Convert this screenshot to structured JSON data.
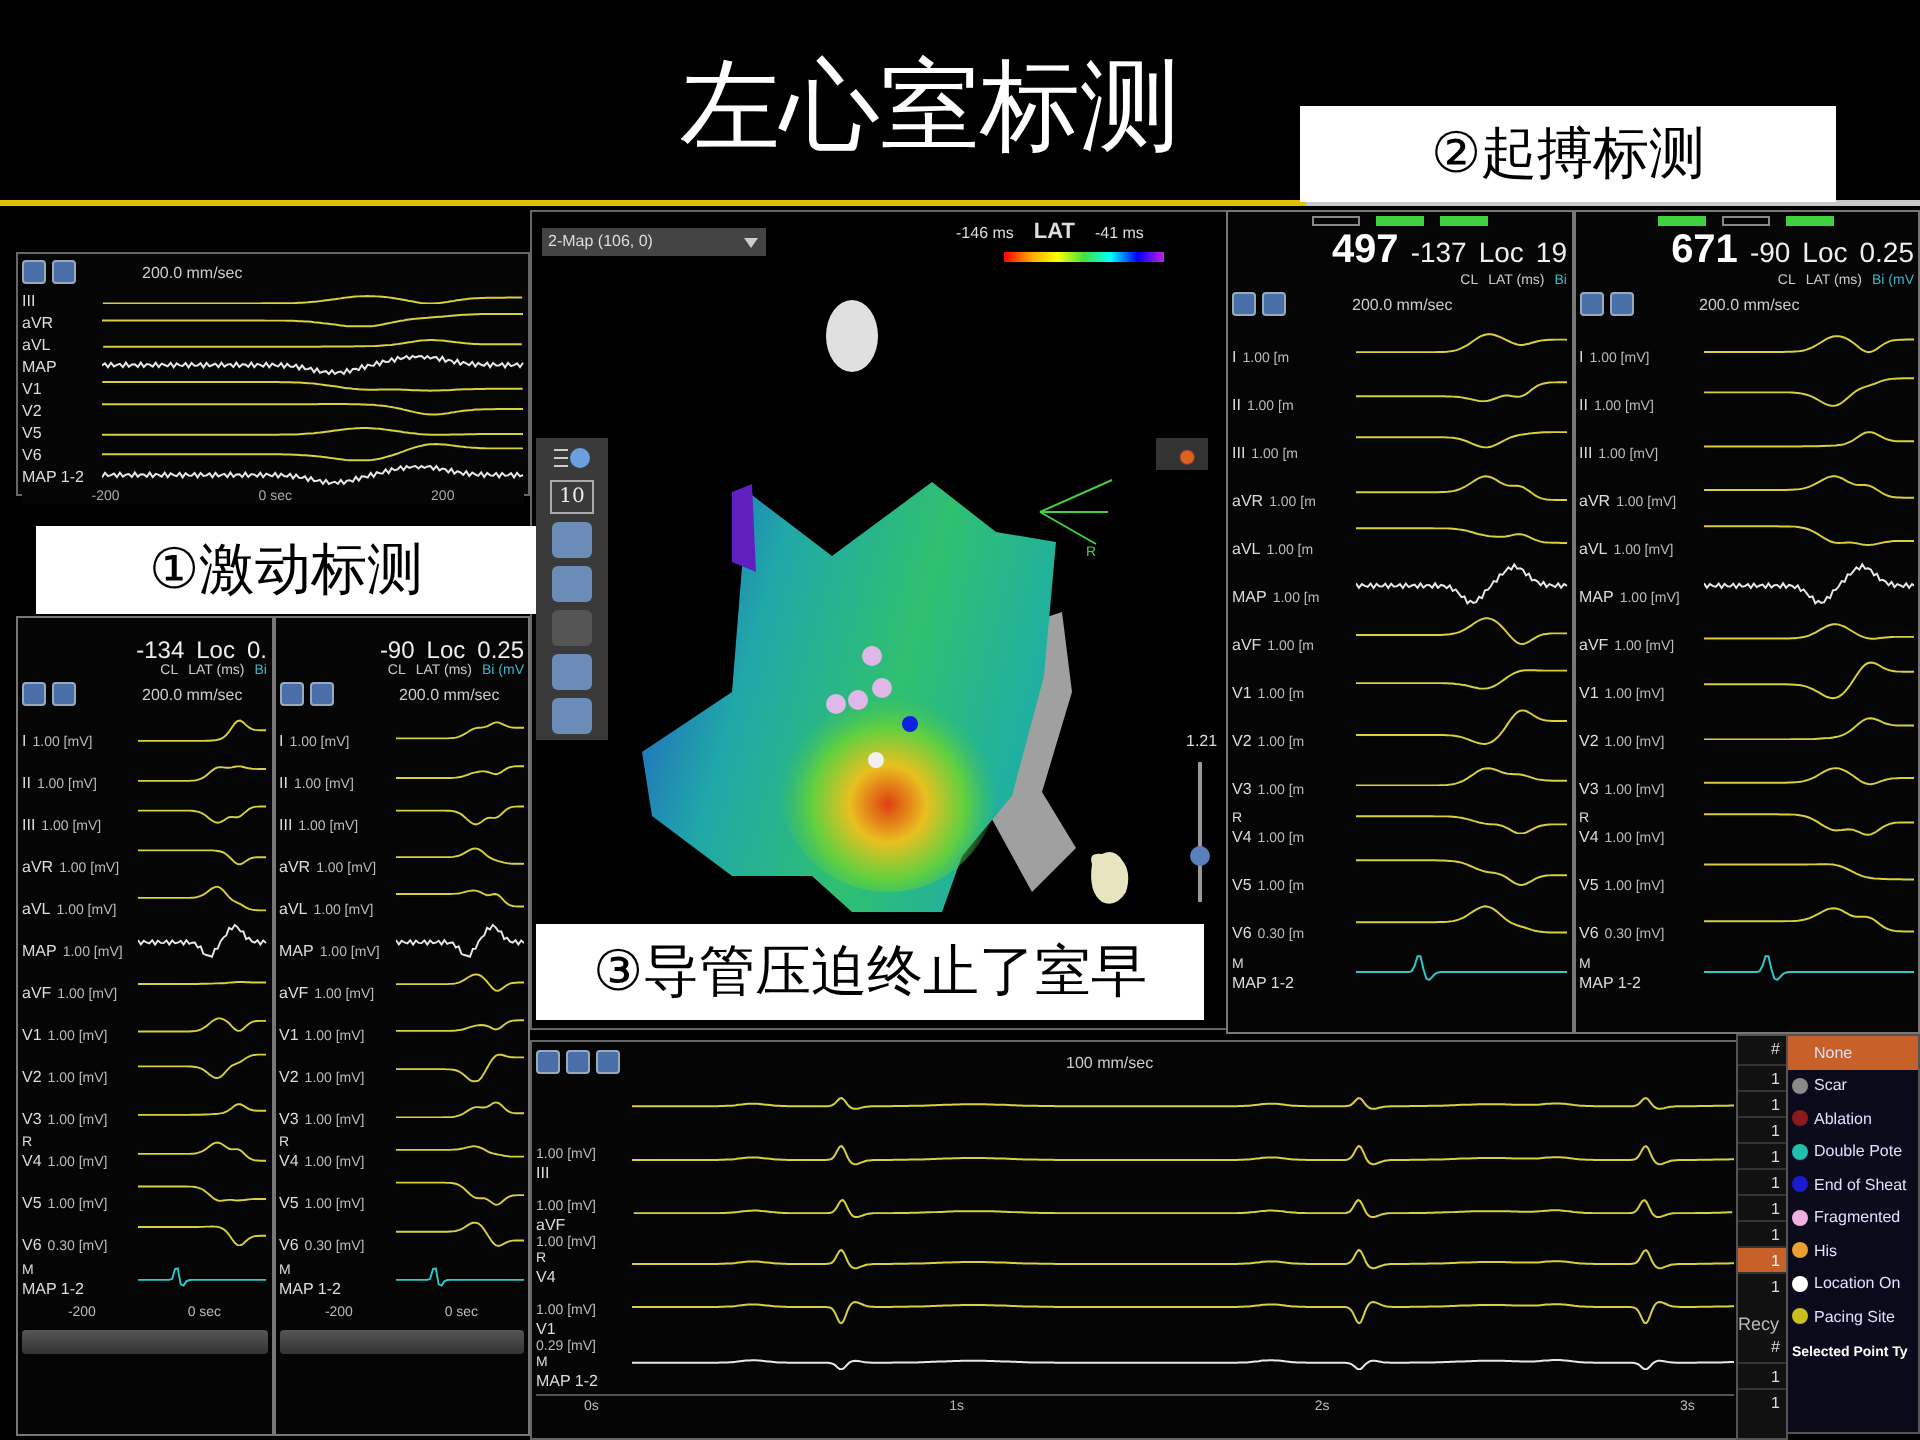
{
  "title": "左心室标测",
  "captions": [
    "①激动标测",
    "②起搏标测",
    "③导管压迫终止了室早"
  ],
  "overview_panel": {
    "speed": "200.0 mm/sec",
    "leads": [
      {
        "label": "III",
        "kind": "surface"
      },
      {
        "label": "aVR",
        "kind": "surface"
      },
      {
        "label": "aVL",
        "kind": "surface"
      },
      {
        "label": "MAP",
        "kind": "map"
      },
      {
        "label": "V1",
        "kind": "surface"
      },
      {
        "label": "V2",
        "kind": "surface"
      },
      {
        "label": "V5",
        "kind": "surface"
      },
      {
        "label": "V6",
        "kind": "surface"
      },
      {
        "label": "MAP 1-2",
        "kind": "map"
      }
    ],
    "ticks": [
      "-200",
      "0 sec",
      "200"
    ]
  },
  "activation_panel": {
    "columns": [
      {
        "header": {
          "lat": "-134",
          "loc_label": "Loc",
          "loc_value": "0.",
          "cl_label": "CL",
          "lat_label": "LAT (ms)",
          "bi_label": "Bi"
        },
        "speed": "200.0 mm/sec",
        "minus": "-200",
        "zero": "0 sec",
        "leads": [
          {
            "label": "I",
            "scale": "1.00 [mV]",
            "kind": "surface"
          },
          {
            "label": "II",
            "scale": "1.00 [mV]",
            "kind": "surface"
          },
          {
            "label": "III",
            "scale": "1.00 [mV]",
            "kind": "surface"
          },
          {
            "label": "aVR",
            "scale": "1.00 [mV]",
            "kind": "surface"
          },
          {
            "label": "aVL",
            "scale": "1.00 [mV]",
            "kind": "surface"
          },
          {
            "label": "MAP",
            "scale": "1.00 [mV]",
            "kind": "map"
          },
          {
            "label": "aVF",
            "scale": "1.00 [mV]",
            "kind": "surface"
          },
          {
            "label": "V1",
            "scale": "1.00 [mV]",
            "kind": "surface"
          },
          {
            "label": "V2",
            "scale": "1.00 [mV]",
            "kind": "surface"
          },
          {
            "label": "V3",
            "scale": "1.00 [mV]",
            "kind": "surface"
          },
          {
            "pre": "R",
            "label": "V4",
            "scale": "1.00 [mV]",
            "kind": "surface"
          },
          {
            "label": "V5",
            "scale": "1.00 [mV]",
            "kind": "surface"
          },
          {
            "label": "V6",
            "scale": "0.30 [mV]",
            "kind": "surface"
          },
          {
            "pre": "M",
            "label": "MAP 1-2",
            "kind": "bipolar"
          }
        ]
      },
      {
        "header": {
          "lat": "-90",
          "loc_label": "Loc",
          "loc_value": "0.25",
          "cl_label": "CL",
          "lat_label": "LAT (ms)",
          "bi_label": "Bi (mV"
        },
        "speed": "200.0 mm/sec",
        "minus": "-200",
        "zero": "0 sec",
        "leads": [
          {
            "label": "I",
            "scale": "1.00 [mV]",
            "kind": "surface"
          },
          {
            "label": "II",
            "scale": "1.00 [mV]",
            "kind": "surface"
          },
          {
            "label": "III",
            "scale": "1.00 [mV]",
            "kind": "surface"
          },
          {
            "label": "aVR",
            "scale": "1.00 [mV]",
            "kind": "surface"
          },
          {
            "label": "aVL",
            "scale": "1.00 [mV]",
            "kind": "surface"
          },
          {
            "label": "MAP",
            "scale": "1.00 [mV]",
            "kind": "map"
          },
          {
            "label": "aVF",
            "scale": "1.00 [mV]",
            "kind": "surface"
          },
          {
            "label": "V1",
            "scale": "1.00 [mV]",
            "kind": "surface"
          },
          {
            "label": "V2",
            "scale": "1.00 [mV]",
            "kind": "surface"
          },
          {
            "label": "V3",
            "scale": "1.00 [mV]",
            "kind": "surface"
          },
          {
            "pre": "R",
            "label": "V4",
            "scale": "1.00 [mV]",
            "kind": "surface"
          },
          {
            "label": "V5",
            "scale": "1.00 [mV]",
            "kind": "surface"
          },
          {
            "label": "V6",
            "scale": "0.30 [mV]",
            "kind": "surface"
          },
          {
            "pre": "M",
            "label": "MAP 1-2",
            "kind": "bipolar"
          }
        ]
      }
    ]
  },
  "map_panel": {
    "map_select": "2-Map (106, 0)",
    "scale_min": "-146 ms",
    "scale_label": "LAT",
    "scale_max": "-41 ms",
    "point_count": "10",
    "axis_label": "R",
    "zoom_slider": {
      "reading": "1.21",
      "level": 0.3
    }
  },
  "pacing_panel": {
    "columns": [
      {
        "indicators": [
          {
            "on": false
          },
          {
            "on": true
          },
          {
            "on": true
          }
        ],
        "header": {
          "cycle": "497",
          "lat": "-137",
          "loc_label": "Loc",
          "loc_value": "19",
          "cl_label": "CL",
          "lat_label": "LAT (ms)",
          "bi_label": "Bi"
        },
        "speed": "200.0 mm/sec",
        "leads": [
          {
            "label": "I",
            "scale": "1.00 [m",
            "kind": "surface"
          },
          {
            "label": "II",
            "scale": "1.00 [m",
            "kind": "surface"
          },
          {
            "label": "III",
            "scale": "1.00 [m",
            "kind": "surface"
          },
          {
            "label": "aVR",
            "scale": "1.00 [m",
            "kind": "surface"
          },
          {
            "label": "aVL",
            "scale": "1.00 [m",
            "kind": "surface"
          },
          {
            "label": "MAP",
            "scale": "1.00 [m",
            "kind": "map"
          },
          {
            "label": "aVF",
            "scale": "1.00 [m",
            "kind": "surface"
          },
          {
            "label": "V1",
            "scale": "1.00 [m",
            "kind": "surface"
          },
          {
            "label": "V2",
            "scale": "1.00 [m",
            "kind": "surface"
          },
          {
            "label": "V3",
            "scale": "1.00 [m",
            "kind": "surface"
          },
          {
            "pre": "R",
            "label": "V4",
            "scale": "1.00 [m",
            "kind": "surface"
          },
          {
            "label": "V5",
            "scale": "1.00 [m",
            "kind": "surface"
          },
          {
            "label": "V6",
            "scale": "0.30 [m",
            "kind": "surface"
          },
          {
            "pre": "M",
            "label": "MAP 1-2",
            "kind": "bipolar"
          }
        ]
      },
      {
        "indicators": [
          {
            "on": true
          },
          {
            "on": false
          },
          {
            "on": true
          }
        ],
        "header": {
          "cycle": "671",
          "lat": "-90",
          "loc_label": "Loc",
          "loc_value": "0.25",
          "cl_label": "CL",
          "lat_label": "LAT (ms)",
          "bi_label": "Bi (mV"
        },
        "speed": "200.0 mm/sec",
        "leads": [
          {
            "label": "I",
            "scale": "1.00 [mV]",
            "kind": "surface"
          },
          {
            "label": "II",
            "scale": "1.00 [mV]",
            "kind": "surface"
          },
          {
            "label": "III",
            "scale": "1.00 [mV]",
            "kind": "surface"
          },
          {
            "label": "aVR",
            "scale": "1.00 [mV]",
            "kind": "surface"
          },
          {
            "label": "aVL",
            "scale": "1.00 [mV]",
            "kind": "surface"
          },
          {
            "label": "MAP",
            "scale": "1.00 [mV]",
            "kind": "map"
          },
          {
            "label": "aVF",
            "scale": "1.00 [mV]",
            "kind": "surface"
          },
          {
            "label": "V1",
            "scale": "1.00 [mV]",
            "kind": "surface"
          },
          {
            "label": "V2",
            "scale": "1.00 [mV]",
            "kind": "surface"
          },
          {
            "label": "V3",
            "scale": "1.00 [mV]",
            "kind": "surface"
          },
          {
            "pre": "R",
            "label": "V4",
            "scale": "1.00 [mV]",
            "kind": "surface"
          },
          {
            "label": "V5",
            "scale": "1.00 [mV]",
            "kind": "surface"
          },
          {
            "label": "V6",
            "scale": "0.30 [mV]",
            "kind": "surface"
          },
          {
            "pre": "M",
            "label": "MAP 1-2",
            "kind": "bipolar"
          }
        ]
      }
    ]
  },
  "strip_panel": {
    "speed": "100 mm/sec",
    "leads": [
      {
        "kind": "surface"
      },
      {
        "label": "III",
        "scale": "1.00 [mV]",
        "kind": "surface"
      },
      {
        "label": "aVF",
        "scale": "1.00 [mV]",
        "kind": "surface"
      },
      {
        "pre": "R",
        "label": "V4",
        "scale": "1.00 [mV]",
        "kind": "surface"
      },
      {
        "label": "V1",
        "scale": "1.00 [mV]",
        "kind": "surface"
      },
      {
        "pre": "M",
        "label": "MAP 1-2",
        "scale": "0.29 [mV]",
        "kind": "map"
      }
    ],
    "time_axis": [
      "0s",
      "1s",
      "2s",
      "3s"
    ]
  },
  "point_table": {
    "header": "#",
    "rows": [
      {
        "value": "1",
        "selected": false
      },
      {
        "value": "1",
        "selected": false
      },
      {
        "value": "1",
        "selected": false
      },
      {
        "value": "1",
        "selected": false
      },
      {
        "value": "1",
        "selected": false
      },
      {
        "value": "1",
        "selected": false
      },
      {
        "value": "1",
        "selected": false
      },
      {
        "value": "1",
        "selected": true
      },
      {
        "value": "1",
        "selected": false
      }
    ],
    "recycle_title": "Recy",
    "recycle_header": "#",
    "recycle_rows": [
      "1",
      "1"
    ]
  },
  "point_type_menu": {
    "items": [
      {
        "label": "None",
        "selected": true
      },
      {
        "label": "Scar",
        "color": "#8a8a8a",
        "selected": false
      },
      {
        "label": "Ablation",
        "color": "#8b1a1a",
        "selected": false
      },
      {
        "label": "Double Pote",
        "color": "#20c0b0",
        "selected": false
      },
      {
        "label": "End of Sheat",
        "color": "#1a1ad0",
        "selected": false
      },
      {
        "label": "Fragmented",
        "color": "#f0b0e0",
        "selected": false
      },
      {
        "label": "His",
        "color": "#e8a030",
        "selected": false
      },
      {
        "label": "Location On",
        "color": "#ffffff",
        "selected": false
      },
      {
        "label": "Pacing Site",
        "color": "#c8c020",
        "selected": false
      }
    ],
    "footer": "Selected Point Ty"
  }
}
